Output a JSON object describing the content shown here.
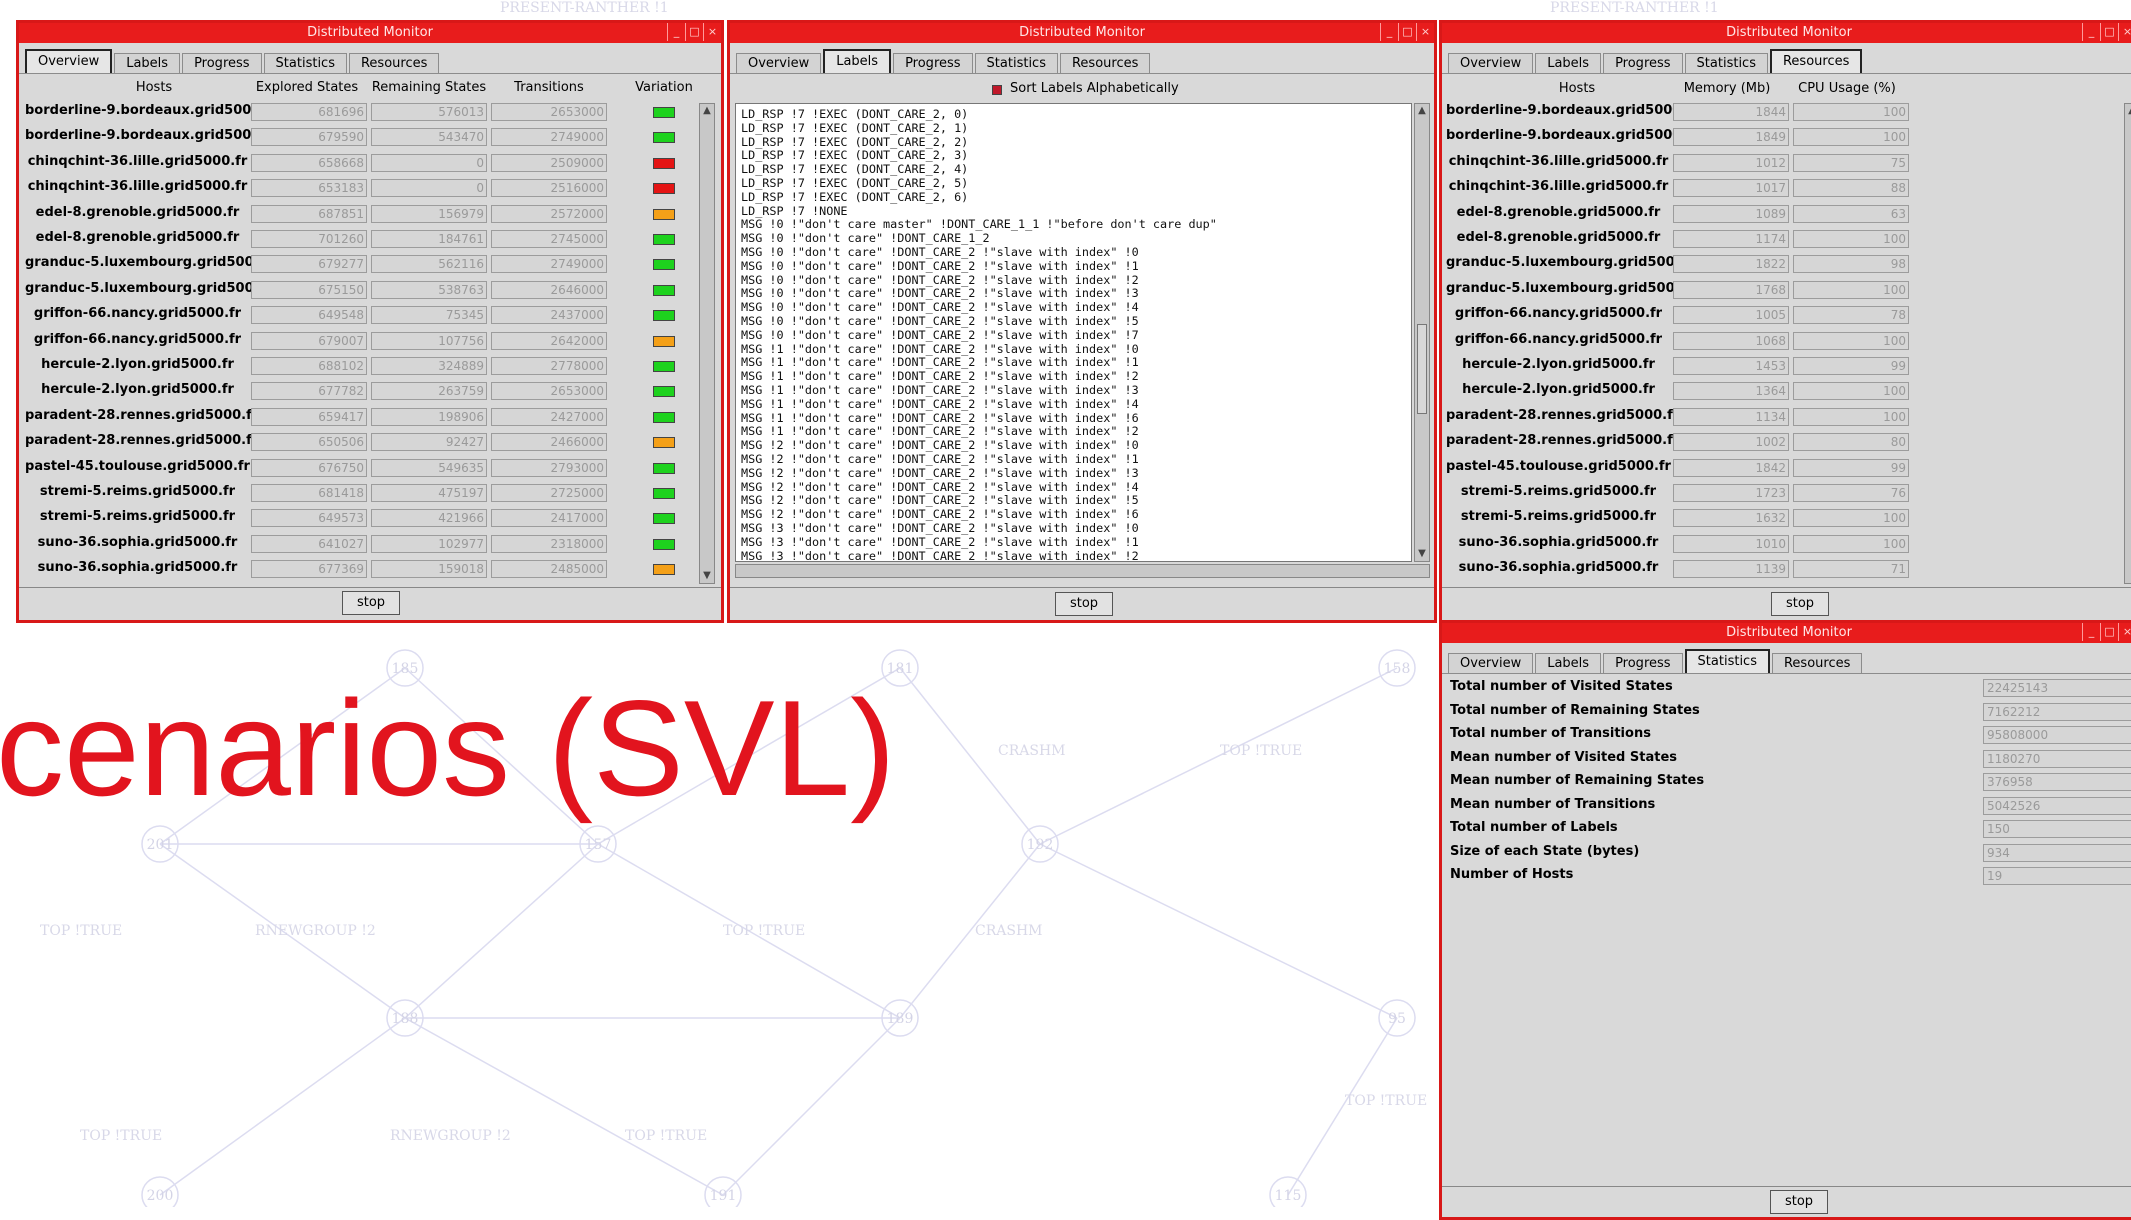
{
  "slide": {
    "title_fragment": "cenarios (SVL)",
    "graph_labels": [
      "TOP !TRUE",
      "RNEWGROUP !2",
      "TOP !TRUE",
      "CRASHM",
      "TOP !TRUE",
      "CRASHM",
      "TOP !TRUE",
      "RNEWGROUP !2",
      "TOP !TRUE",
      "TOP !TRUE",
      "PRESENT-RANTHER !1",
      "PRESENT-RANTHER !1"
    ],
    "graph_nodes": [
      "185",
      "181",
      "158",
      "201",
      "157",
      "192",
      "188",
      "189",
      "95",
      "200",
      "191",
      "115"
    ]
  },
  "windows": {
    "title": "Distributed Monitor",
    "tabs": [
      "Overview",
      "Labels",
      "Progress",
      "Statistics",
      "Resources"
    ],
    "stop_label": "stop",
    "title_buttons": [
      "_",
      "□",
      "×"
    ]
  },
  "overview": {
    "columns": [
      "Hosts",
      "Explored States",
      "Remaining States",
      "Transitions",
      "Variation"
    ],
    "rows": [
      {
        "host": "borderline-9.bordeaux.grid5000.fr",
        "explored": "681696",
        "remaining": "576013",
        "transitions": "2653000",
        "variation": "green"
      },
      {
        "host": "borderline-9.bordeaux.grid5000.fr",
        "explored": "679590",
        "remaining": "543470",
        "transitions": "2749000",
        "variation": "green"
      },
      {
        "host": "chinqchint-36.lille.grid5000.fr",
        "explored": "658668",
        "remaining": "0",
        "transitions": "2509000",
        "variation": "red"
      },
      {
        "host": "chinqchint-36.lille.grid5000.fr",
        "explored": "653183",
        "remaining": "0",
        "transitions": "2516000",
        "variation": "red"
      },
      {
        "host": "edel-8.grenoble.grid5000.fr",
        "explored": "687851",
        "remaining": "156979",
        "transitions": "2572000",
        "variation": "orange"
      },
      {
        "host": "edel-8.grenoble.grid5000.fr",
        "explored": "701260",
        "remaining": "184761",
        "transitions": "2745000",
        "variation": "green"
      },
      {
        "host": "granduc-5.luxembourg.grid5000.fr",
        "explored": "679277",
        "remaining": "562116",
        "transitions": "2749000",
        "variation": "green"
      },
      {
        "host": "granduc-5.luxembourg.grid5000.fr",
        "explored": "675150",
        "remaining": "538763",
        "transitions": "2646000",
        "variation": "green"
      },
      {
        "host": "griffon-66.nancy.grid5000.fr",
        "explored": "649548",
        "remaining": "75345",
        "transitions": "2437000",
        "variation": "green"
      },
      {
        "host": "griffon-66.nancy.grid5000.fr",
        "explored": "679007",
        "remaining": "107756",
        "transitions": "2642000",
        "variation": "orange"
      },
      {
        "host": "hercule-2.lyon.grid5000.fr",
        "explored": "688102",
        "remaining": "324889",
        "transitions": "2778000",
        "variation": "green"
      },
      {
        "host": "hercule-2.lyon.grid5000.fr",
        "explored": "677782",
        "remaining": "263759",
        "transitions": "2653000",
        "variation": "green"
      },
      {
        "host": "paradent-28.rennes.grid5000.fr",
        "explored": "659417",
        "remaining": "198906",
        "transitions": "2427000",
        "variation": "green"
      },
      {
        "host": "paradent-28.rennes.grid5000.fr",
        "explored": "650506",
        "remaining": "92427",
        "transitions": "2466000",
        "variation": "orange"
      },
      {
        "host": "pastel-45.toulouse.grid5000.fr",
        "explored": "676750",
        "remaining": "549635",
        "transitions": "2793000",
        "variation": "green"
      },
      {
        "host": "stremi-5.reims.grid5000.fr",
        "explored": "681418",
        "remaining": "475197",
        "transitions": "2725000",
        "variation": "green"
      },
      {
        "host": "stremi-5.reims.grid5000.fr",
        "explored": "649573",
        "remaining": "421966",
        "transitions": "2417000",
        "variation": "green"
      },
      {
        "host": "suno-36.sophia.grid5000.fr",
        "explored": "641027",
        "remaining": "102977",
        "transitions": "2318000",
        "variation": "green"
      },
      {
        "host": "suno-36.sophia.grid5000.fr",
        "explored": "677369",
        "remaining": "159018",
        "transitions": "2485000",
        "variation": "orange"
      }
    ]
  },
  "labels": {
    "sort_checkbox_label": "Sort Labels Alphabetically",
    "lines": [
      "LD_RSP !7 !EXEC (DONT_CARE_2, 0)",
      "LD_RSP !7 !EXEC (DONT_CARE_2, 1)",
      "LD_RSP !7 !EXEC (DONT_CARE_2, 2)",
      "LD_RSP !7 !EXEC (DONT_CARE_2, 3)",
      "LD_RSP !7 !EXEC (DONT_CARE_2, 4)",
      "LD_RSP !7 !EXEC (DONT_CARE_2, 5)",
      "LD_RSP !7 !EXEC (DONT_CARE_2, 6)",
      "LD_RSP !7 !NONE",
      "MSG !0 !\"don't care master\" !DONT_CARE_1_1 !\"before don't care dup\"",
      "MSG !0 !\"don't care\" !DONT_CARE_1_2",
      "MSG !0 !\"don't care\" !DONT_CARE_2 !\"slave with index\" !0",
      "MSG !0 !\"don't care\" !DONT_CARE_2 !\"slave with index\" !1",
      "MSG !0 !\"don't care\" !DONT_CARE_2 !\"slave with index\" !2",
      "MSG !0 !\"don't care\" !DONT_CARE_2 !\"slave with index\" !3",
      "MSG !0 !\"don't care\" !DONT_CARE_2 !\"slave with index\" !4",
      "MSG !0 !\"don't care\" !DONT_CARE_2 !\"slave with index\" !5",
      "MSG !0 !\"don't care\" !DONT_CARE_2 !\"slave with index\" !7",
      "MSG !1 !\"don't care\" !DONT_CARE_2 !\"slave with index\" !0",
      "MSG !1 !\"don't care\" !DONT_CARE_2 !\"slave with index\" !1",
      "MSG !1 !\"don't care\" !DONT_CARE_2 !\"slave with index\" !2",
      "MSG !1 !\"don't care\" !DONT_CARE_2 !\"slave with index\" !3",
      "MSG !1 !\"don't care\" !DONT_CARE_2 !\"slave with index\" !4",
      "MSG !1 !\"don't care\" !DONT_CARE_2 !\"slave with index\" !6",
      "MSG !1 !\"don't care\" !DONT_CARE_2 !\"slave with index\" !2",
      "MSG !2 !\"don't care\" !DONT_CARE_2 !\"slave with index\" !0",
      "MSG !2 !\"don't care\" !DONT_CARE_2 !\"slave with index\" !1",
      "MSG !2 !\"don't care\" !DONT_CARE_2 !\"slave with index\" !3",
      "MSG !2 !\"don't care\" !DONT_CARE_2 !\"slave with index\" !4",
      "MSG !2 !\"don't care\" !DONT_CARE_2 !\"slave with index\" !5",
      "MSG !2 !\"don't care\" !DONT_CARE_2 !\"slave with index\" !6",
      "MSG !3 !\"don't care\" !DONT_CARE_2 !\"slave with index\" !0",
      "MSG !3 !\"don't care\" !DONT_CARE_2 !\"slave with index\" !1",
      "MSG !3 !\"don't care\" !DONT_CARE_2 !\"slave with index\" !2"
    ]
  },
  "resources": {
    "columns": [
      "Hosts",
      "Memory (Mb)",
      "CPU Usage (%)"
    ],
    "rows": [
      {
        "host": "borderline-9.bordeaux.grid5000.fr",
        "memory": "1844",
        "cpu": "100"
      },
      {
        "host": "borderline-9.bordeaux.grid5000.fr",
        "memory": "1849",
        "cpu": "100"
      },
      {
        "host": "chinqchint-36.lille.grid5000.fr",
        "memory": "1012",
        "cpu": "75"
      },
      {
        "host": "chinqchint-36.lille.grid5000.fr",
        "memory": "1017",
        "cpu": "88"
      },
      {
        "host": "edel-8.grenoble.grid5000.fr",
        "memory": "1089",
        "cpu": "63"
      },
      {
        "host": "edel-8.grenoble.grid5000.fr",
        "memory": "1174",
        "cpu": "100"
      },
      {
        "host": "granduc-5.luxembourg.grid5000.fr",
        "memory": "1822",
        "cpu": "98"
      },
      {
        "host": "granduc-5.luxembourg.grid5000.fr",
        "memory": "1768",
        "cpu": "100"
      },
      {
        "host": "griffon-66.nancy.grid5000.fr",
        "memory": "1005",
        "cpu": "78"
      },
      {
        "host": "griffon-66.nancy.grid5000.fr",
        "memory": "1068",
        "cpu": "100"
      },
      {
        "host": "hercule-2.lyon.grid5000.fr",
        "memory": "1453",
        "cpu": "99"
      },
      {
        "host": "hercule-2.lyon.grid5000.fr",
        "memory": "1364",
        "cpu": "100"
      },
      {
        "host": "paradent-28.rennes.grid5000.fr",
        "memory": "1134",
        "cpu": "100"
      },
      {
        "host": "paradent-28.rennes.grid5000.fr",
        "memory": "1002",
        "cpu": "80"
      },
      {
        "host": "pastel-45.toulouse.grid5000.fr",
        "memory": "1842",
        "cpu": "99"
      },
      {
        "host": "stremi-5.reims.grid5000.fr",
        "memory": "1723",
        "cpu": "76"
      },
      {
        "host": "stremi-5.reims.grid5000.fr",
        "memory": "1632",
        "cpu": "100"
      },
      {
        "host": "suno-36.sophia.grid5000.fr",
        "memory": "1010",
        "cpu": "100"
      },
      {
        "host": "suno-36.sophia.grid5000.fr",
        "memory": "1139",
        "cpu": "71"
      }
    ]
  },
  "statistics": {
    "rows": [
      {
        "label": "Total number of Visited States",
        "value": "22425143"
      },
      {
        "label": "Total number of Remaining States",
        "value": "7162212"
      },
      {
        "label": "Total number of Transitions",
        "value": "95808000"
      },
      {
        "label": "Mean number of Visited States",
        "value": "1180270"
      },
      {
        "label": "Mean number of Remaining States",
        "value": "376958"
      },
      {
        "label": "Mean number of Transitions",
        "value": "5042526"
      },
      {
        "label": "Total number of Labels",
        "value": "150"
      },
      {
        "label": "Size of each State (bytes)",
        "value": "934"
      },
      {
        "label": "Number of Hosts",
        "value": "19"
      }
    ]
  },
  "colors": {
    "titlebar": "#e81c1c",
    "window_border": "#d81818",
    "slide_title": "#e2141e",
    "variation_green": "#1ed21e",
    "variation_red": "#e41414",
    "variation_orange": "#f4a018"
  }
}
